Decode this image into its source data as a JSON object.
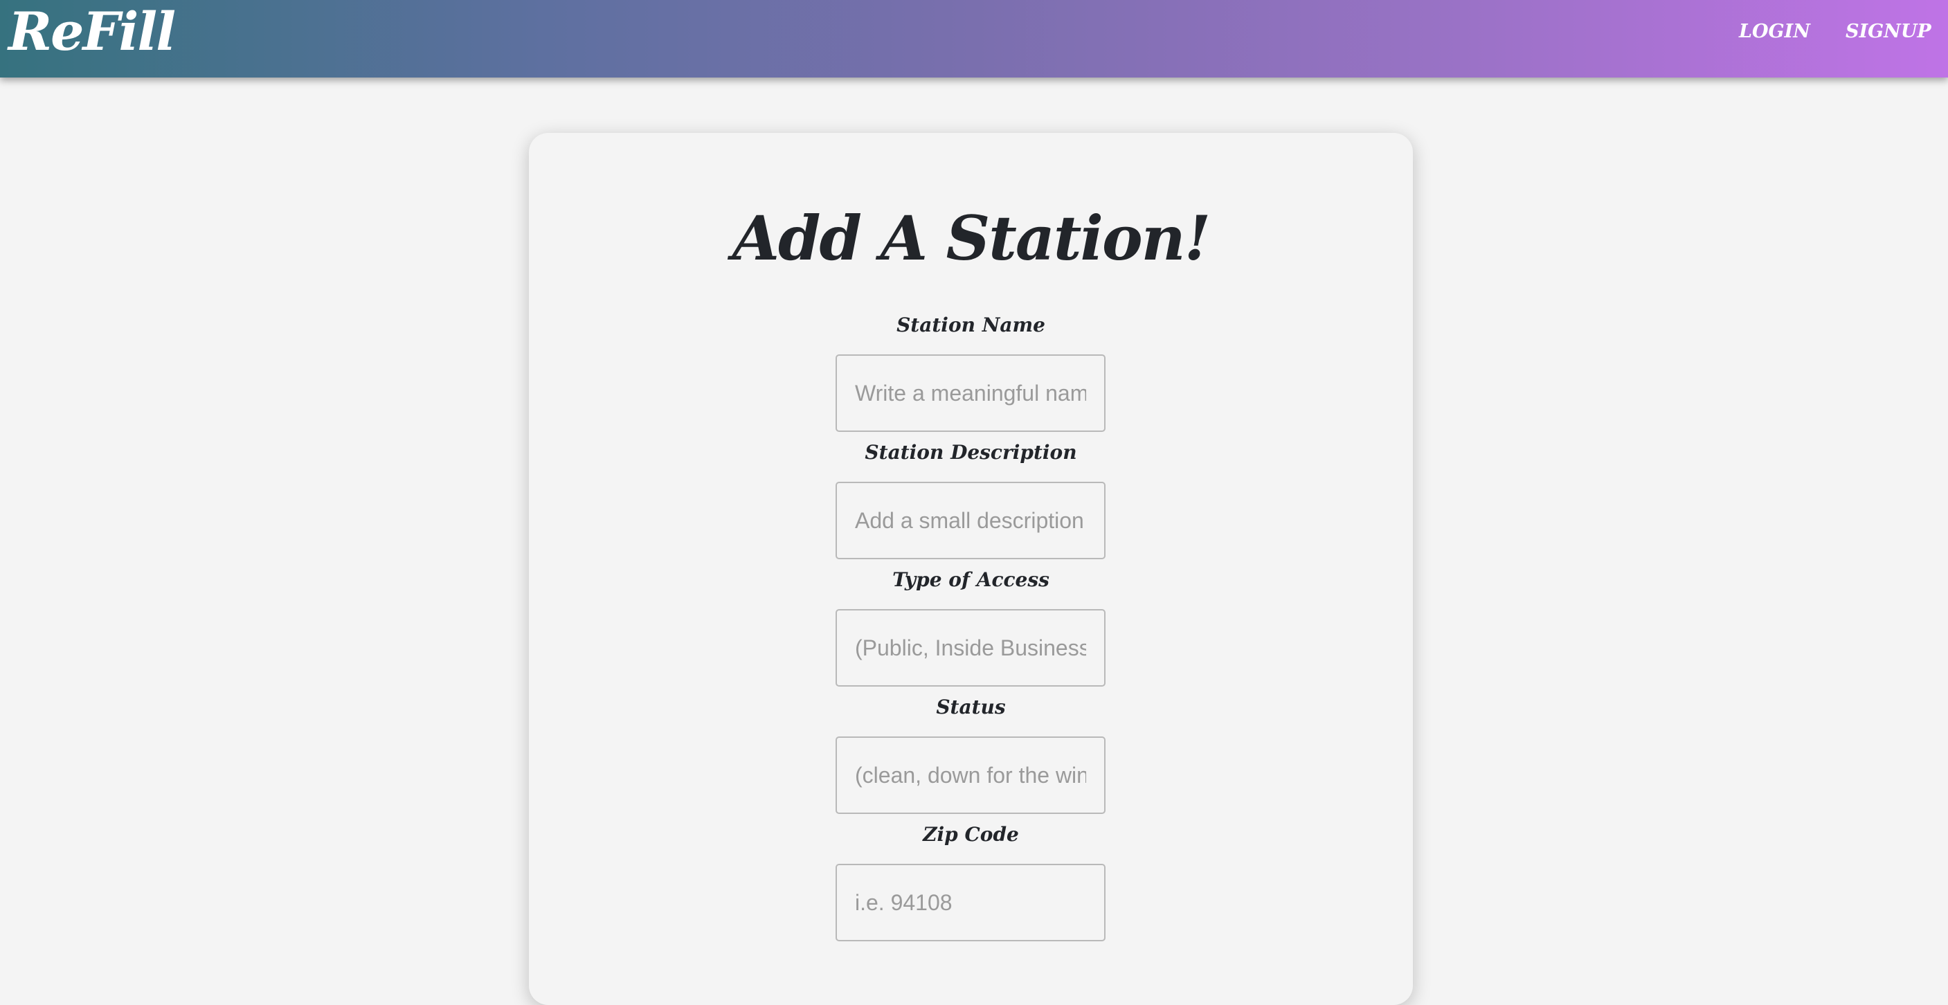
{
  "nav": {
    "brand": "ReFill",
    "login_label": "Login",
    "signup_label": "Signup"
  },
  "form": {
    "title": "Add A Station!",
    "fields": [
      {
        "label": "Station Name",
        "placeholder": "Write a meaningful name",
        "value": ""
      },
      {
        "label": "Station Description",
        "placeholder": "Add a small description",
        "value": ""
      },
      {
        "label": "Type of Access",
        "placeholder": "(Public, Inside Business",
        "value": ""
      },
      {
        "label": "Status",
        "placeholder": "(clean, down for the winter",
        "value": ""
      },
      {
        "label": "Zip Code",
        "placeholder": "i.e. 94108",
        "value": ""
      }
    ]
  },
  "colors": {
    "nav_gradient_start": "#36727f",
    "nav_gradient_end": "#bf73e6",
    "page_background": "#f4f4f4",
    "text_dark": "#22252a"
  }
}
